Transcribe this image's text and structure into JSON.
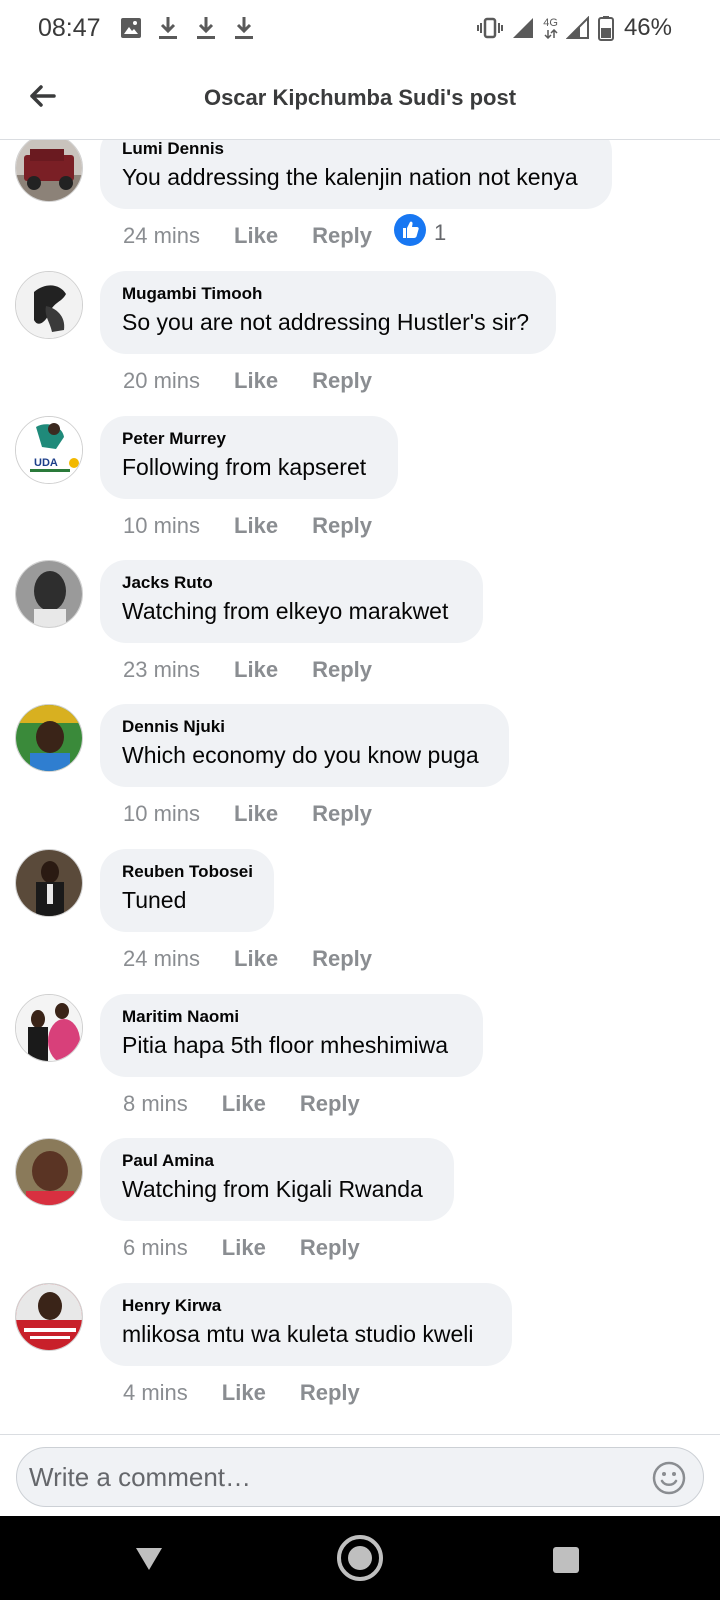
{
  "status_bar": {
    "time": "08:47",
    "network_label": "4G",
    "battery_percent": "46%"
  },
  "header": {
    "title": "Oscar Kipchumba Sudi's post"
  },
  "comments": [
    {
      "author": "Lumi Dennis",
      "text": "You addressing the kalenjin nation not kenya",
      "time": "24 mins",
      "like_label": "Like",
      "reply_label": "Reply",
      "reaction_count": "1"
    },
    {
      "author": "Mugambi Timooh",
      "text": "So you are not addressing Hustler's sir?",
      "time": "20 mins",
      "like_label": "Like",
      "reply_label": "Reply"
    },
    {
      "author": "Peter Murrey",
      "text": "Following from kapseret",
      "time": "10 mins",
      "like_label": "Like",
      "reply_label": "Reply",
      "avatar_text": "UDA"
    },
    {
      "author": "Jacks Ruto",
      "text": "Watching from elkeyo marakwet",
      "time": "23 mins",
      "like_label": "Like",
      "reply_label": "Reply"
    },
    {
      "author": "Dennis Njuki",
      "text": "Which economy do you know puga",
      "time": "10 mins",
      "like_label": "Like",
      "reply_label": "Reply"
    },
    {
      "author": "Reuben Tobosei",
      "text": "Tuned",
      "time": "24 mins",
      "like_label": "Like",
      "reply_label": "Reply"
    },
    {
      "author": "Maritim Naomi",
      "text": "Pitia hapa 5th floor mheshimiwa",
      "time": "8 mins",
      "like_label": "Like",
      "reply_label": "Reply"
    },
    {
      "author": "Paul Amina",
      "text": "Watching from Kigali Rwanda",
      "time": "6 mins",
      "like_label": "Like",
      "reply_label": "Reply"
    },
    {
      "author": "Henry Kirwa",
      "text": "mlikosa mtu wa kuleta studio kweli",
      "time": "4 mins",
      "like_label": "Like",
      "reply_label": "Reply"
    }
  ],
  "composer": {
    "placeholder": "Write a comment…"
  },
  "colors": {
    "bubble": "#f0f2f5",
    "meta_text": "#8a8d91",
    "like_blue": "#1877f2"
  }
}
